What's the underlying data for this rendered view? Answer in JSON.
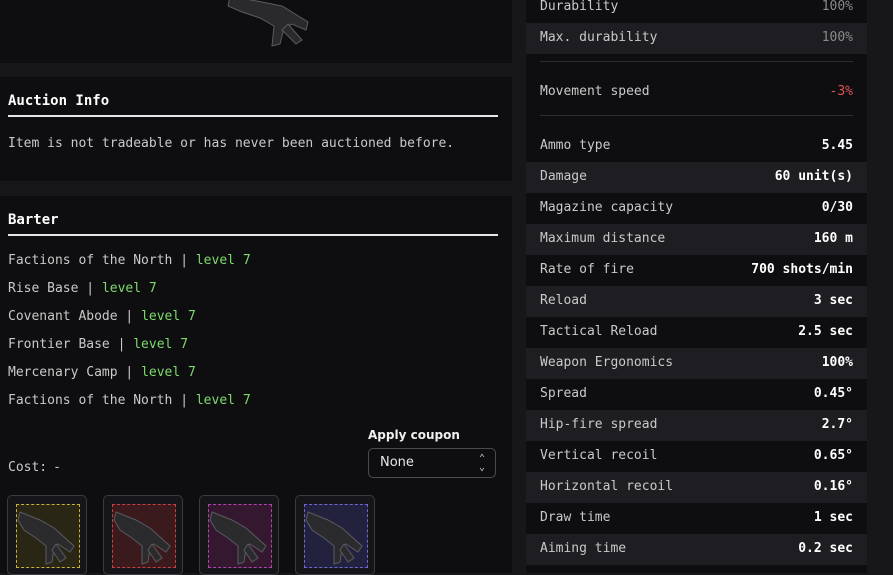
{
  "auction": {
    "title": "Auction Info",
    "text": "Item is not tradeable or has never been auctioned before."
  },
  "barter": {
    "title": "Barter",
    "rows": [
      {
        "name": "Factions of the North",
        "sep": "|",
        "level": "level 7"
      },
      {
        "name": "Rise Base",
        "sep": "|",
        "level": "level 7"
      },
      {
        "name": "Covenant Abode",
        "sep": "|",
        "level": "level 7"
      },
      {
        "name": "Frontier Base",
        "sep": "|",
        "level": "level 7"
      },
      {
        "name": "Mercenary Camp",
        "sep": "|",
        "level": "level 7"
      },
      {
        "name": "Factions of the North",
        "sep": "|",
        "level": "level 7"
      }
    ],
    "coupon_label": "Apply coupon",
    "coupon_value": "None",
    "cost_label": "Cost:",
    "cost_value": "-",
    "slots": [
      {
        "rarity_color": "#c9b233",
        "bg": "#2a2616",
        "icon": "rifle-icon"
      },
      {
        "rarity_color": "#c94040",
        "bg": "#3a1a1c",
        "icon": "rifle-icon"
      },
      {
        "rarity_color": "#b046a8",
        "bg": "#33182f",
        "icon": "rifle-icon"
      },
      {
        "rarity_color": "#6a6ad0",
        "bg": "#22223e",
        "icon": "rifle-icon"
      }
    ]
  },
  "stats_a": [
    {
      "label": "Durability",
      "value": "100%",
      "style": "dim"
    },
    {
      "label": "Max. durability",
      "value": "100%",
      "style": "dim"
    }
  ],
  "stats_b": [
    {
      "label": "Movement speed",
      "value": "-3%",
      "style": "neg"
    }
  ],
  "stats_c": [
    {
      "label": "Ammo type",
      "value": "5.45"
    },
    {
      "label": "Damage",
      "value": "60 unit(s)"
    },
    {
      "label": "Magazine capacity",
      "value": "0/30"
    },
    {
      "label": "Maximum distance",
      "value": "160 m"
    },
    {
      "label": "Rate of fire",
      "value": "700 shots/min"
    },
    {
      "label": "Reload",
      "value": "3 sec"
    },
    {
      "label": "Tactical Reload",
      "value": "2.5 sec"
    },
    {
      "label": "Weapon Ergonomics",
      "value": "100%"
    },
    {
      "label": "Spread",
      "value": "0.45°"
    },
    {
      "label": "Hip-fire spread",
      "value": "2.7°"
    },
    {
      "label": "Vertical recoil",
      "value": "0.65°"
    },
    {
      "label": "Horizontal recoil",
      "value": "0.16°"
    },
    {
      "label": "Draw time",
      "value": "1 sec"
    },
    {
      "label": "Aiming time",
      "value": "0.2 sec"
    }
  ]
}
